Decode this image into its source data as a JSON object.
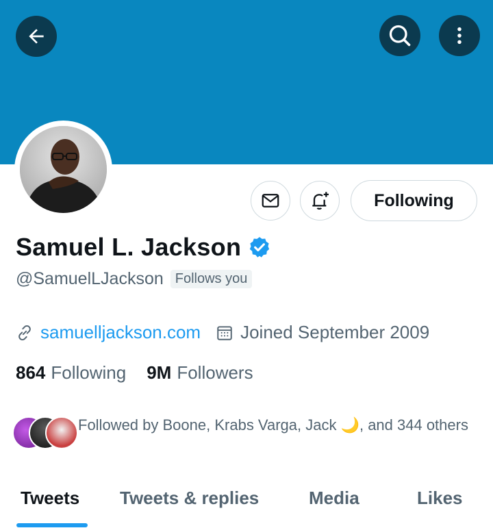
{
  "header": {
    "back_icon": "arrow-left-icon",
    "search_icon": "search-icon",
    "more_icon": "more-vertical-icon",
    "banner_color": "#0987bf"
  },
  "profile": {
    "name": "Samuel L. Jackson",
    "verified": true,
    "handle": "@SamuelLJackson",
    "follows_you": "Follows you",
    "website": "samuelljackson.com",
    "joined": "Joined September 2009",
    "following_count": "864",
    "following_label": "Following",
    "followers_count": "9M",
    "followers_label": "Followers",
    "followed_by": "Followed by Boone, Krabs Varga, Jack 🌙, and 344 others"
  },
  "actions": {
    "message_icon": "envelope-icon",
    "notify_icon": "bell-plus-icon",
    "following_button": "Following"
  },
  "tabs": [
    {
      "label": "Tweets",
      "active": true
    },
    {
      "label": "Tweets & replies",
      "active": false
    },
    {
      "label": "Media",
      "active": false
    },
    {
      "label": "Likes",
      "active": false
    }
  ],
  "colors": {
    "accent": "#1d9bf0",
    "secondary_text": "#536471",
    "primary_text": "#0f1419"
  }
}
